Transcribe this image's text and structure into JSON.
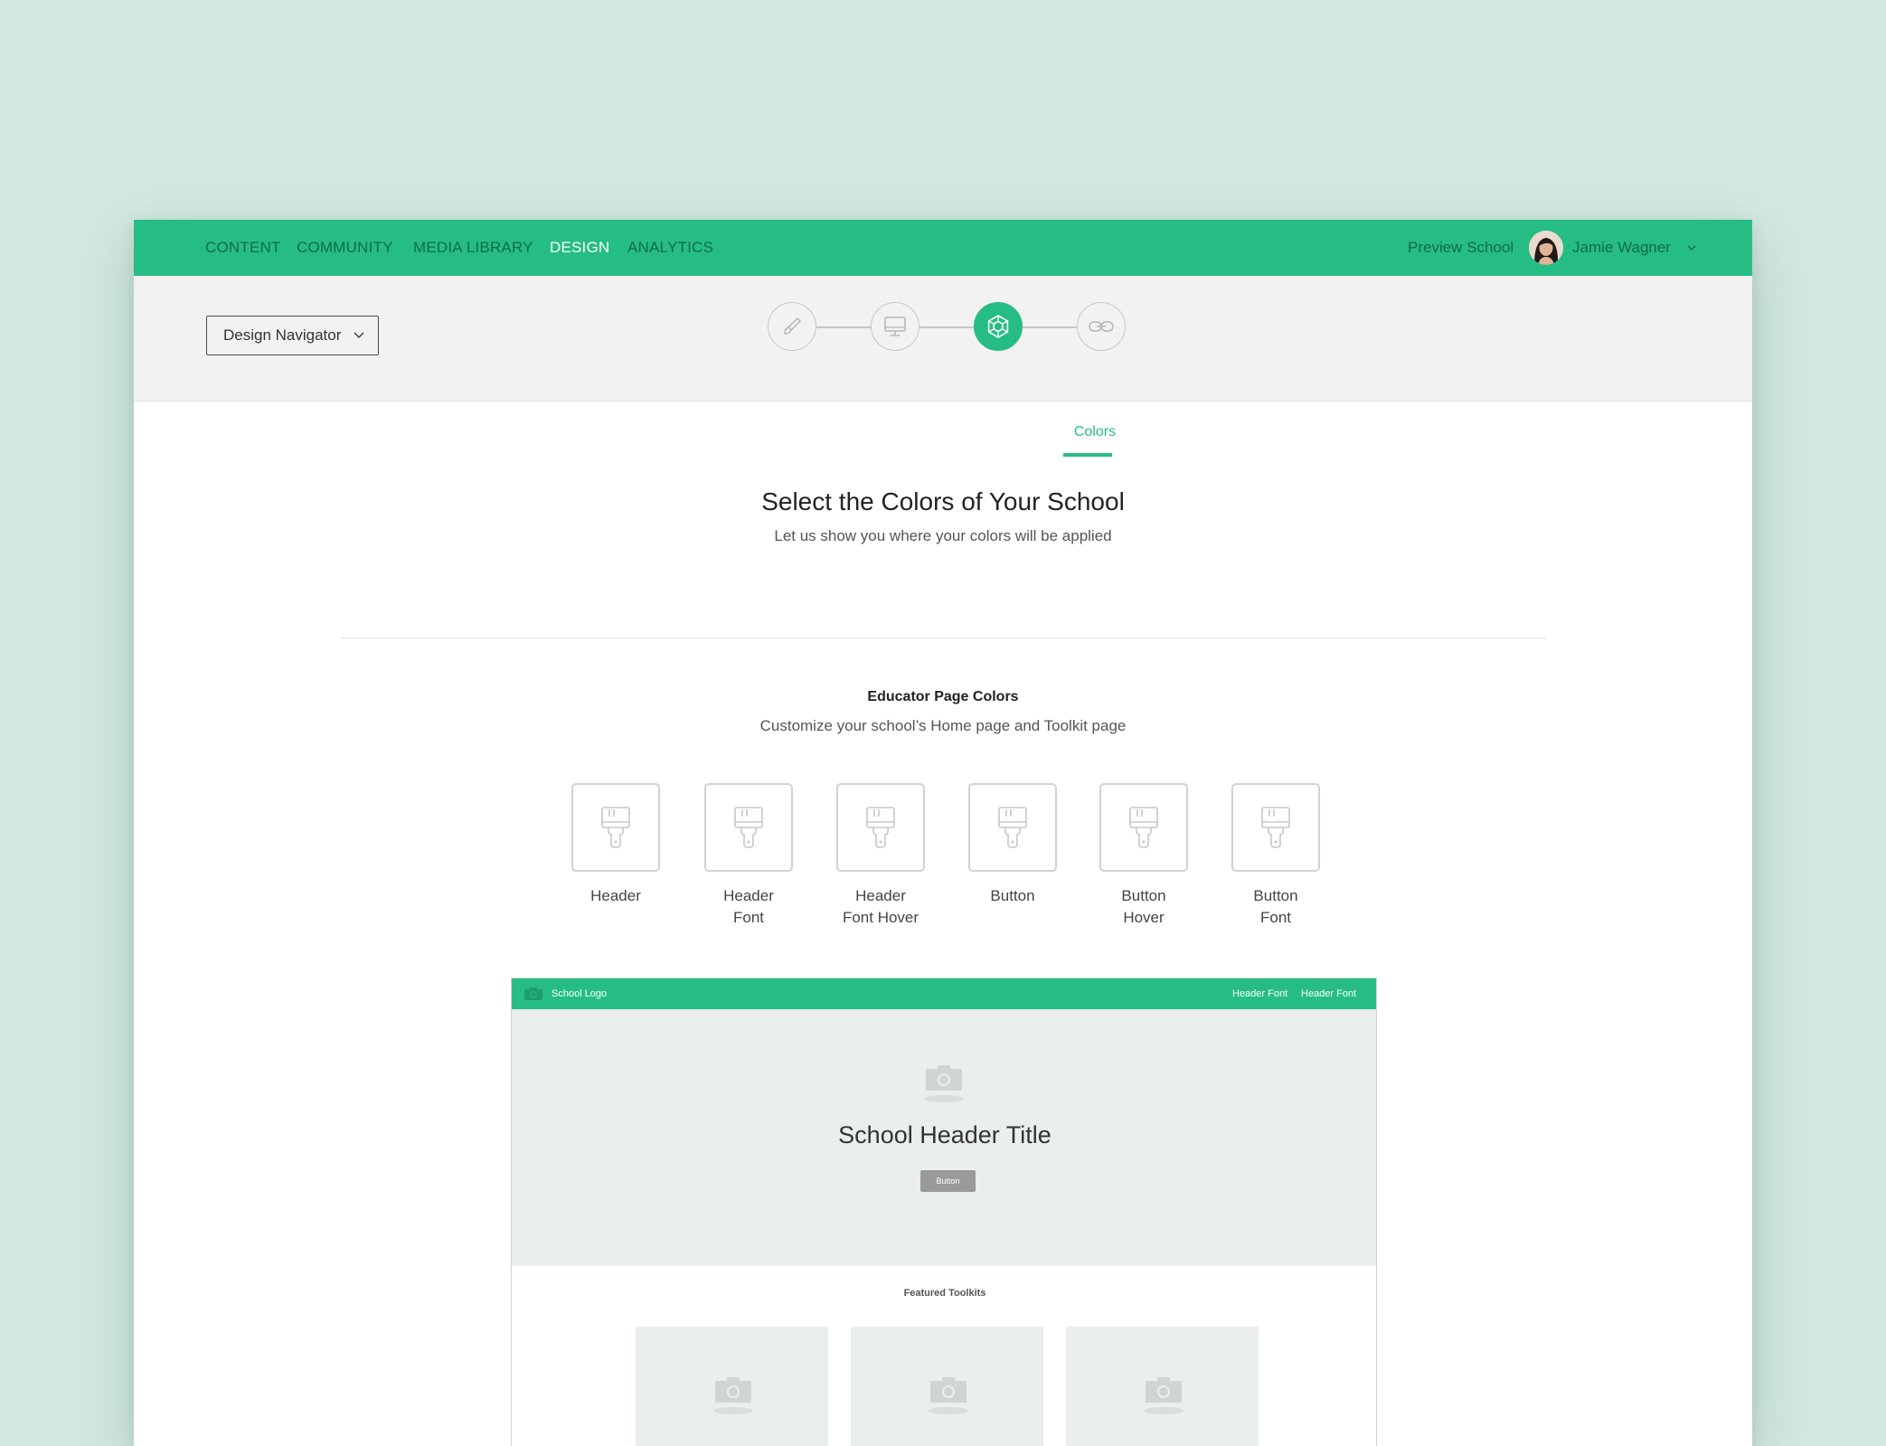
{
  "nav": {
    "items": [
      {
        "label": "CONTENT",
        "active": false
      },
      {
        "label": "COMMUNITY",
        "active": false
      },
      {
        "label": "MEDIA LIBRARY",
        "active": false
      },
      {
        "label": "DESIGN",
        "active": true
      },
      {
        "label": "ANALYTICS",
        "active": false
      }
    ],
    "preview_label": "Preview School",
    "user_name": "Jamie Wagner"
  },
  "stepbar": {
    "design_navigator_label": "Design Navigator",
    "steps": [
      {
        "icon": "paintbrush-icon",
        "active": false
      },
      {
        "icon": "monitor-icon",
        "active": false
      },
      {
        "icon": "color-wheel-icon",
        "active": true
      },
      {
        "icon": "link-icon",
        "active": false
      }
    ],
    "active_label": "Colors"
  },
  "main": {
    "title": "Select the Colors of Your School",
    "subtitle": "Let us show you where your colors will be applied",
    "section_title": "Educator Page Colors",
    "section_subtitle": "Customize your school’s Home page and Toolkit page",
    "swatches": [
      {
        "label": "Header"
      },
      {
        "label": "Header\nFont"
      },
      {
        "label": "Header\nFont Hover"
      },
      {
        "label": "Button"
      },
      {
        "label": "Button\nHover"
      },
      {
        "label": "Button\nFont"
      }
    ]
  },
  "preview": {
    "logo_label": "School Logo",
    "header_links": [
      "Header Font",
      "Header Font"
    ],
    "hero_title": "School Header Title",
    "hero_button": "Button",
    "featured_label": "Featured Toolkits"
  },
  "colors": {
    "brand_green": "#26bd85",
    "nav_text": "#0f6b4a",
    "background": "#d3e8e1"
  }
}
